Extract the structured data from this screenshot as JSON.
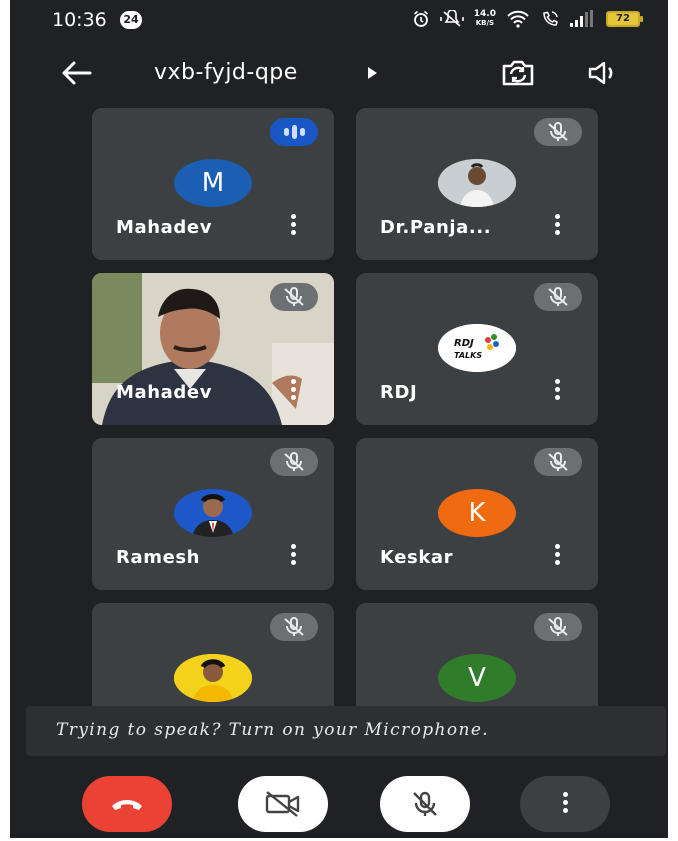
{
  "status_bar": {
    "time": "10:36",
    "notification_count": "24",
    "net_speed_value": "14.0",
    "net_speed_unit": "KB/S",
    "battery": "72"
  },
  "app_bar": {
    "meeting_code": "vxb-fyjd-qpe"
  },
  "participants": [
    {
      "name": "Mahadev",
      "avatar_letter": "M",
      "avatar_color": "#1a5fb4",
      "mic": "speaking"
    },
    {
      "name": "Dr.Panja...",
      "avatar_letter": "",
      "avatar_color": "#bfc4c9",
      "mic": "muted"
    },
    {
      "name": "Mahadev",
      "avatar_letter": "",
      "avatar_color": "",
      "mic": "muted",
      "video": true
    },
    {
      "name": "RDJ",
      "avatar_letter": "",
      "avatar_color": "#ffffff",
      "mic": "muted",
      "logo_text": "RDJ TALKS"
    },
    {
      "name": "Ramesh",
      "avatar_letter": "",
      "avatar_color": "#1e57c8",
      "mic": "muted"
    },
    {
      "name": "Keskar",
      "avatar_letter": "K",
      "avatar_color": "#f06a12",
      "mic": "muted"
    },
    {
      "name": "",
      "avatar_letter": "",
      "avatar_color": "#f2d21b",
      "mic": "muted"
    },
    {
      "name": "",
      "avatar_letter": "V",
      "avatar_color": "#2f7d2a",
      "mic": "muted"
    }
  ],
  "toast": {
    "text": "Trying to speak? Turn on your Microphone."
  },
  "colors": {
    "background": "#202124",
    "tile": "#3c4043",
    "end_call": "#ea4335",
    "speaking": "#1a56c4"
  },
  "icons": {
    "back": "arrow-left-icon",
    "switch_camera": "camera-switch-icon",
    "speaker": "speaker-icon",
    "end_call": "phone-hangup-icon",
    "camera_off": "video-off-icon",
    "mic_off": "mic-off-icon",
    "more": "more-vert-icon"
  }
}
